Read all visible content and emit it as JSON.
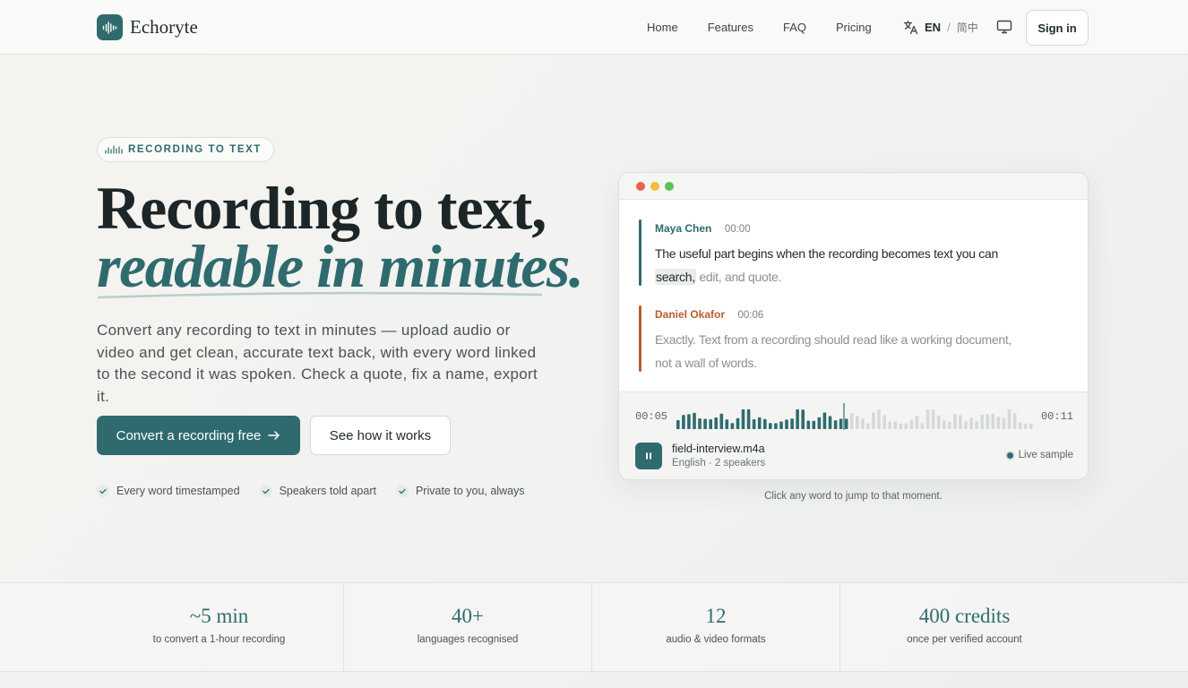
{
  "brand": {
    "name": "Echoryte",
    "logo_icon": "waveform-icon"
  },
  "nav": {
    "links": [
      "Home",
      "Features",
      "FAQ",
      "Pricing"
    ],
    "lang_current": "EN",
    "lang_sep": "/",
    "lang_alt": "简中",
    "signin_label": "Sign in"
  },
  "hero": {
    "pill_label": "RECORDING TO TEXT",
    "title_line1": "Recording to text,",
    "title_line2": "readable in minutes.",
    "lead": "Convert any recording to text in minutes — upload audio or video and get clean, accurate text back, with every word linked to the second it was spoken. Check a quote, fix a name, export it.",
    "cta_primary": "Convert a recording free",
    "cta_secondary": "See how it works",
    "features": [
      "Every word timestamped",
      "Speakers told apart",
      "Private to you, always"
    ]
  },
  "transcript": {
    "segments": [
      {
        "speaker": "Maya Chen",
        "time": "00:00",
        "text_before": "The useful part begins when the recording becomes text you can ",
        "highlight": "search,",
        "text_after": " edit, and quote.",
        "color": "#2f6b6e"
      },
      {
        "speaker": "Daniel Okafor",
        "time": "00:06",
        "text": "Exactly. Text from a recording should read like a working document, not a wall of words.",
        "color": "#b85c2e"
      }
    ],
    "player": {
      "time_current": "00:05",
      "time_total": "00:11",
      "progress": 0.47,
      "file_name": "field-interview.m4a",
      "file_meta": "English · 2 speakers",
      "live_label": "Live sample"
    },
    "caption": "Click any word to jump to that moment."
  },
  "stats": [
    {
      "value": "~5 min",
      "label": "to convert a 1-hour recording"
    },
    {
      "value": "40+",
      "label": "languages recognised"
    },
    {
      "value": "12",
      "label": "audio & video formats"
    },
    {
      "value": "400 credits",
      "label": "once per verified account"
    }
  ],
  "colors": {
    "accent": "#2f6b6e",
    "speaker2": "#b85c2e"
  }
}
